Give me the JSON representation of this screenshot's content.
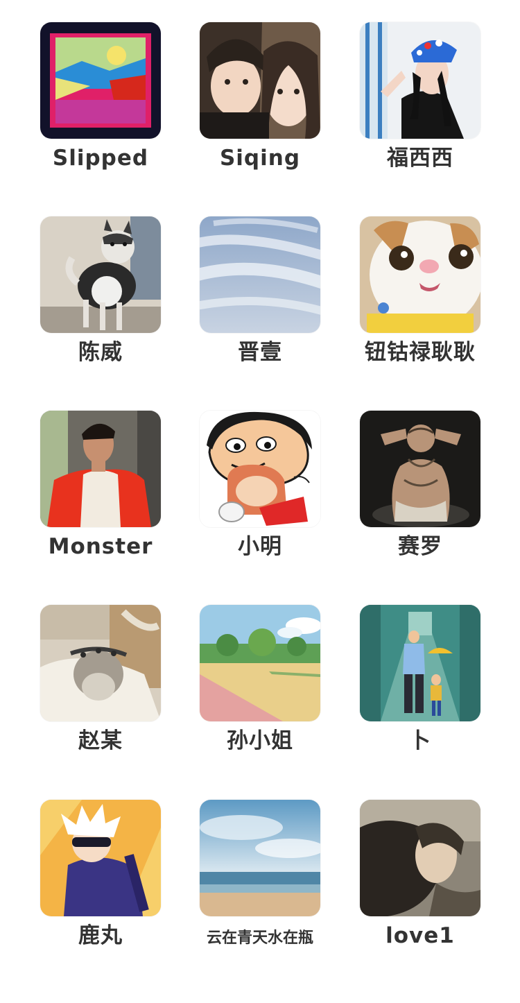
{
  "contacts": [
    {
      "name": "Slipped",
      "avatar": "framed-landscape-painting"
    },
    {
      "name": "Siqing",
      "avatar": "cartoon-couple"
    },
    {
      "name": "福西西",
      "avatar": "woman-with-bucket-hat"
    },
    {
      "name": "陈威",
      "avatar": "husky-dog"
    },
    {
      "name": "晋壹",
      "avatar": "cloudy-sky"
    },
    {
      "name": "钮钴禄耿耿",
      "avatar": "white-cat-closeup"
    },
    {
      "name": "Monster",
      "avatar": "man-in-red-jacket"
    },
    {
      "name": "小明",
      "avatar": "crayon-shin-chan-cartoon"
    },
    {
      "name": "赛罗",
      "avatar": "tattooed-baby"
    },
    {
      "name": "赵某",
      "avatar": "cat-on-blanket"
    },
    {
      "name": "孙小姐",
      "avatar": "park-path"
    },
    {
      "name": "卜",
      "avatar": "father-and-child-illustration"
    },
    {
      "name": "鹿丸",
      "avatar": "anime-character-white-hair"
    },
    {
      "name": "云在青天水在瓶",
      "avatar": "beach-sky"
    },
    {
      "name": "love1",
      "avatar": "woman-portrait-painting"
    }
  ]
}
